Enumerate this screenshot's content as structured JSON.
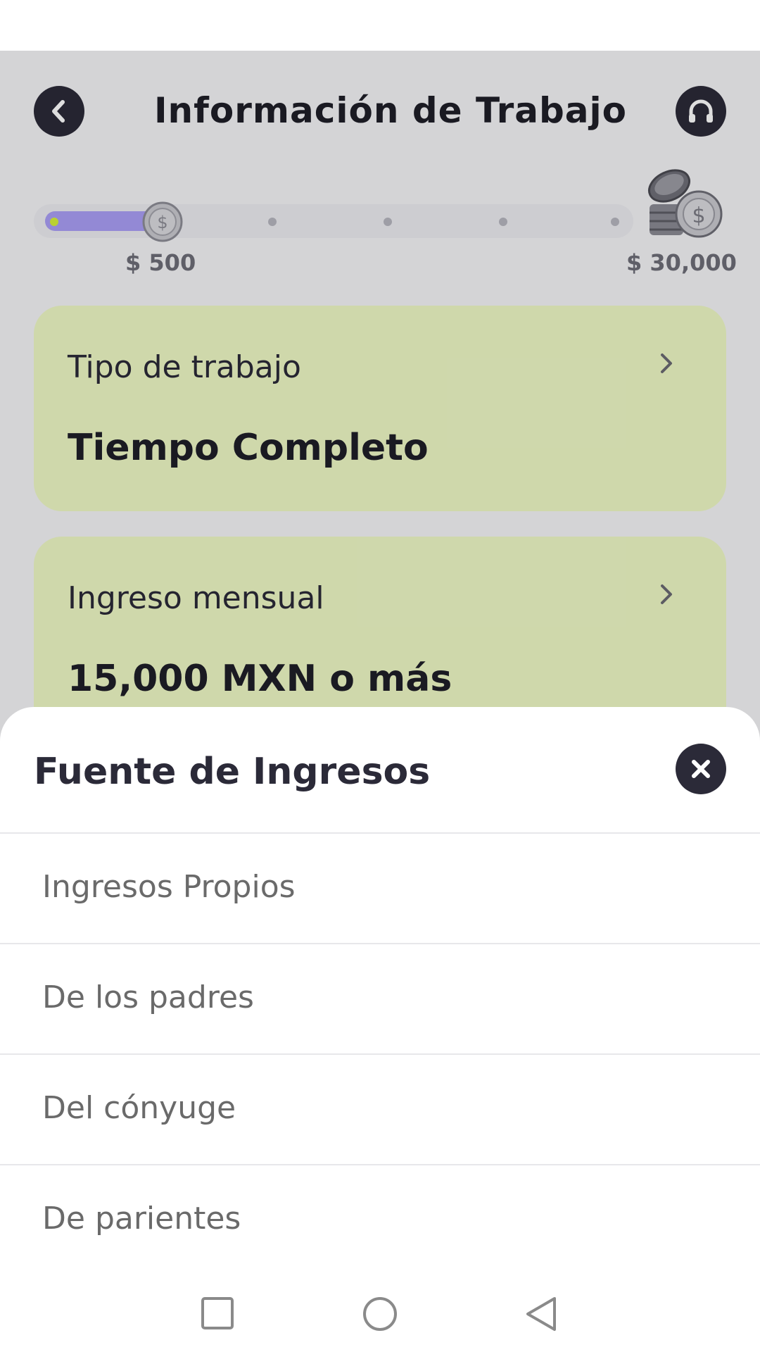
{
  "header": {
    "title": "Información de Trabajo",
    "back_icon": "chevron-left-icon",
    "support_icon": "headset-icon"
  },
  "progress": {
    "min_label": "$ 500",
    "max_label": "$ 30,000",
    "fraction": 0.2,
    "steps": 5,
    "fill_color": "#a99ef5",
    "start_dot_color": "#d6f03a"
  },
  "cards": [
    {
      "label": "Tipo de trabajo",
      "value": "Tiempo Completo"
    },
    {
      "label": "Ingreso mensual",
      "value": "15,000 MXN o más"
    }
  ],
  "sheet": {
    "title": "Fuente de Ingresos",
    "close_icon": "close-icon",
    "options": [
      "Ingresos Propios",
      "De los padres",
      "Del cónyuge",
      "De parientes"
    ]
  },
  "nav": {
    "recent_icon": "square-icon",
    "home_icon": "circle-icon",
    "back_icon": "triangle-back-icon"
  },
  "colors": {
    "card_bg": "#eef8c5",
    "dark": "#2b2a38"
  }
}
